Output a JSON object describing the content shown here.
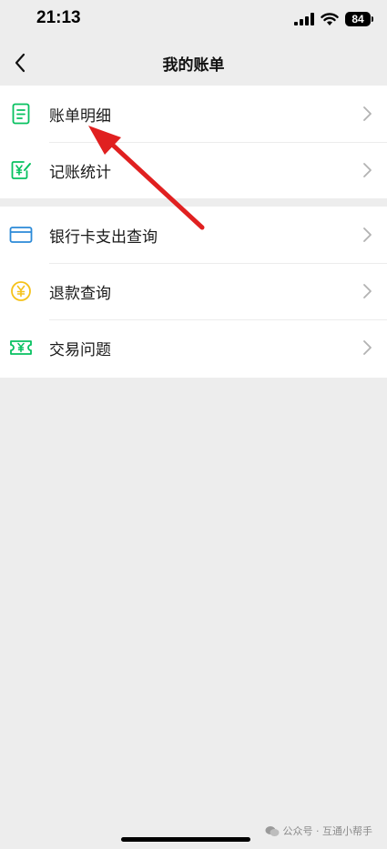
{
  "status": {
    "time": "21:13",
    "battery": "84"
  },
  "nav": {
    "title": "我的账单"
  },
  "groups": [
    {
      "items": [
        {
          "label": "账单明细",
          "icon": "bill-detail-icon"
        },
        {
          "label": "记账统计",
          "icon": "bookkeeping-stats-icon"
        }
      ]
    },
    {
      "items": [
        {
          "label": "银行卡支出查询",
          "icon": "bank-card-icon"
        },
        {
          "label": "退款查询",
          "icon": "refund-coin-icon"
        },
        {
          "label": "交易问题",
          "icon": "transaction-ticket-icon"
        }
      ]
    }
  ],
  "watermark": {
    "text": "公众号 · 互通小帮手"
  },
  "colors": {
    "accent": "#07c160",
    "coin": "#f5c21a",
    "card": "#2b8ad8",
    "arrow": "#e02020"
  }
}
